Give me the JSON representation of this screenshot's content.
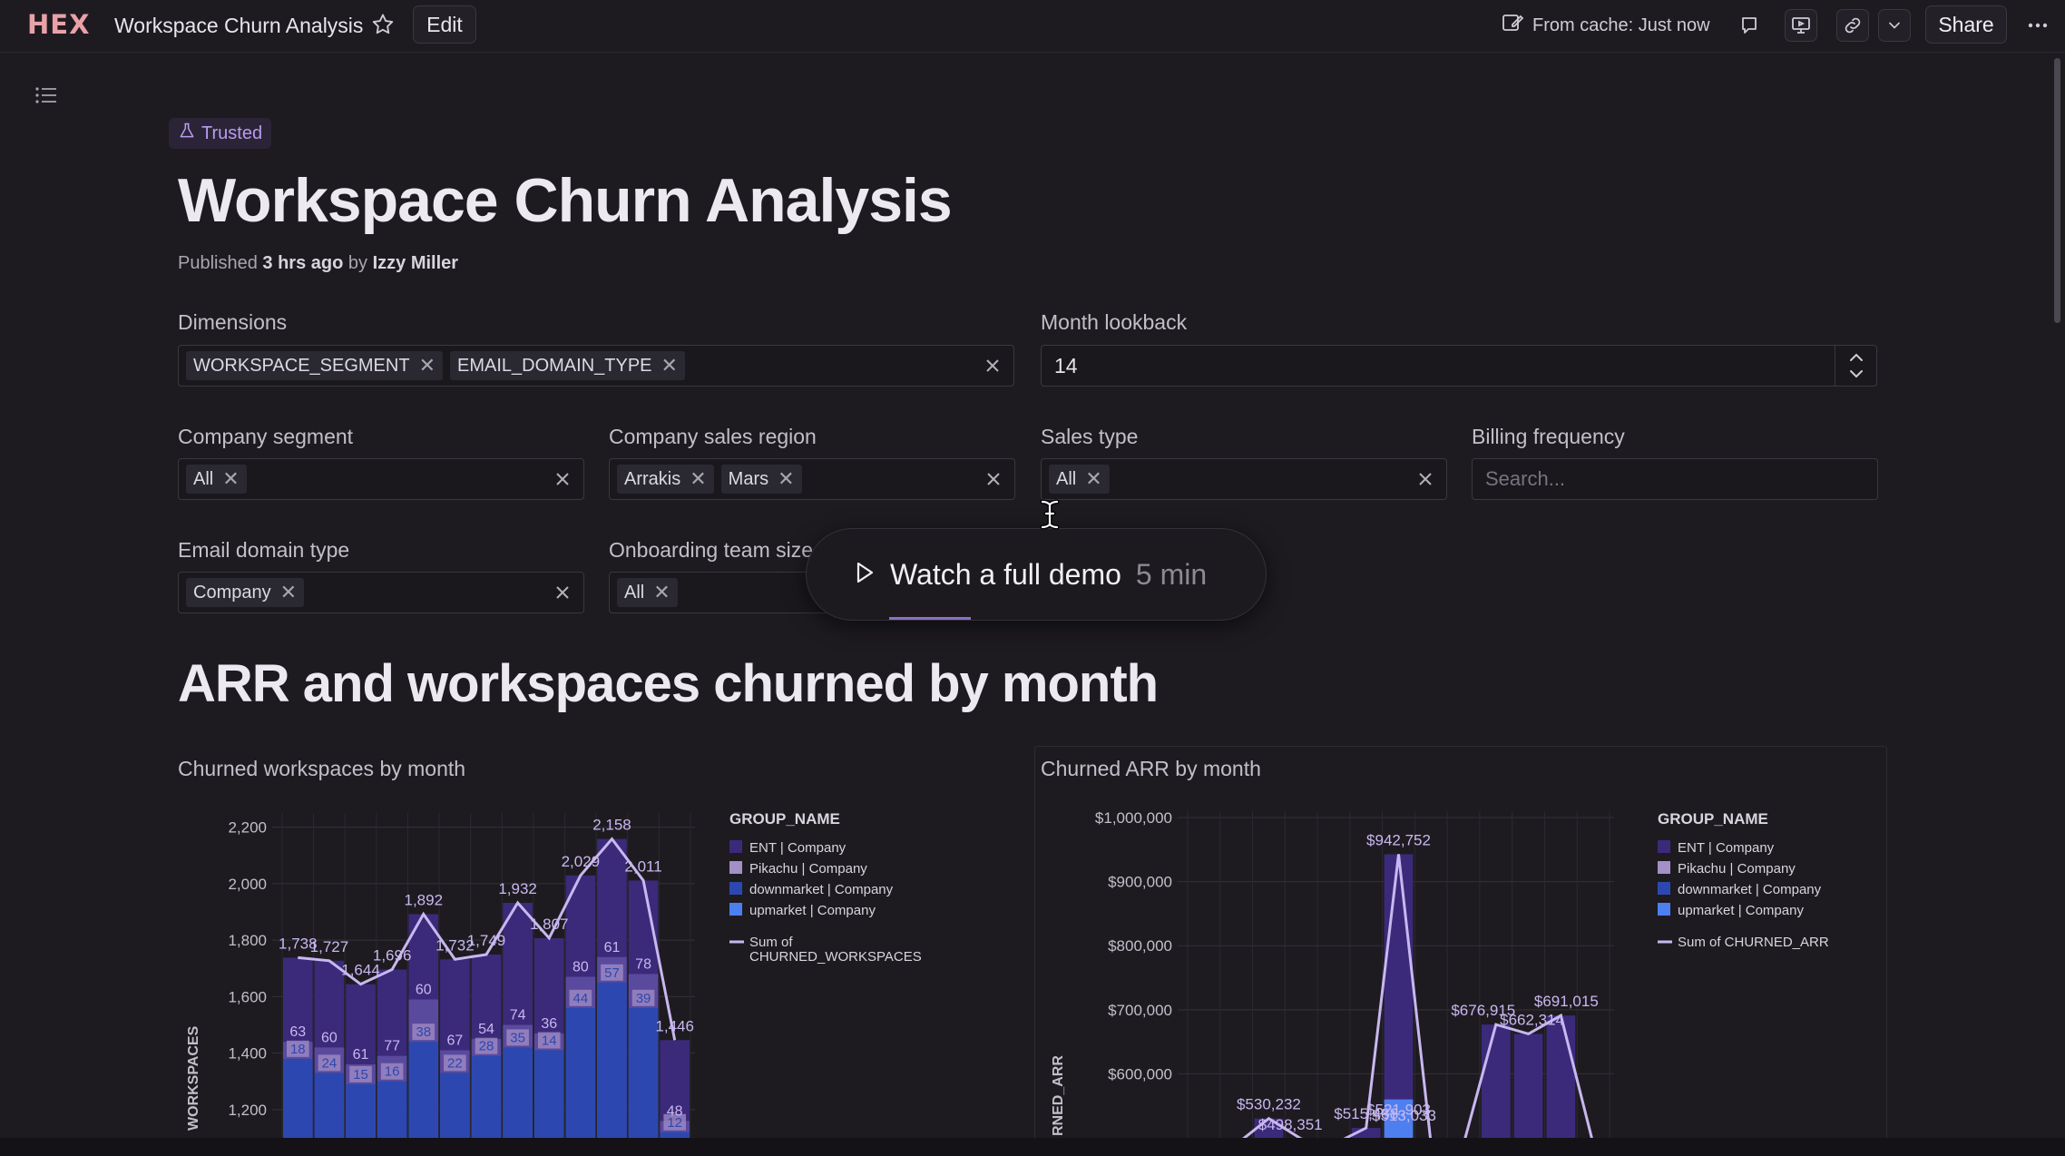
{
  "app": {
    "logo": "HEX",
    "doc_title": "Workspace Churn Analysis",
    "edit_label": "Edit",
    "cache_status": "From cache: Just now",
    "share_label": "Share"
  },
  "header": {
    "badge": "Trusted",
    "title": "Workspace Churn Analysis",
    "published_prefix": "Published",
    "published_time": "3 hrs ago",
    "published_by": "by",
    "author": "Izzy Miller"
  },
  "inputs": {
    "dimensions": {
      "label": "Dimensions",
      "tags": [
        "WORKSPACE_SEGMENT",
        "EMAIL_DOMAIN_TYPE"
      ]
    },
    "month_lookback": {
      "label": "Month lookback",
      "value": "14"
    },
    "company_segment": {
      "label": "Company segment",
      "tags": [
        "All"
      ]
    },
    "company_sales_region": {
      "label": "Company sales region",
      "tags": [
        "Arrakis",
        "Mars"
      ]
    },
    "sales_type": {
      "label": "Sales type",
      "tags": [
        "All"
      ]
    },
    "billing_frequency": {
      "label": "Billing frequency",
      "placeholder": "Search..."
    },
    "email_domain_type": {
      "label": "Email domain type",
      "tags": [
        "Company"
      ]
    },
    "onboarding_team_size": {
      "label": "Onboarding team size",
      "tags": [
        "All"
      ]
    }
  },
  "demo": {
    "label": "Watch a full demo",
    "duration": "5 min"
  },
  "section": {
    "title": "ARR and workspaces churned by month"
  },
  "icons": {
    "star": "star-icon",
    "outline": "outline-list-icon",
    "cache": "cache-edit-icon",
    "comment": "comment-icon",
    "present": "present-icon",
    "link": "link-icon",
    "chevron": "chevron-down-icon",
    "more": "more-icon",
    "play": "play-icon",
    "trusted": "trusted-flask-icon"
  },
  "colors": {
    "ent": "#3b2a7a",
    "pikachu": "#a48fc6",
    "downmarket": "#2c48b0",
    "upmarket": "#4d7ff0",
    "line": "#c9b7f0",
    "accent": "#b89cf0",
    "logo": "#e9a1a8"
  },
  "chart_data": [
    {
      "type": "bar",
      "title": "Churned workspaces by month",
      "ylabel": "WORKSPACES",
      "ylim": [
        1100,
        2250
      ],
      "yticks": [
        "2,200",
        "2,000",
        "1,800",
        "1,600",
        "1,400",
        "1,200"
      ],
      "legend_title": "GROUP_NAME",
      "legend": [
        "ENT | Company",
        "Pikachu | Company",
        "downmarket | Company",
        "upmarket | Company"
      ],
      "line_legend": [
        "Sum of",
        "CHURNED_WORKSPACES"
      ],
      "line_series": {
        "name": "Sum of CHURNED_WORKSPACES",
        "values": [
          1738,
          1727,
          1644,
          1696,
          1892,
          1732,
          1749,
          1932,
          1807,
          2029,
          2158,
          2011,
          1446
        ],
        "labels": [
          "1,738",
          "1,727",
          "1,644",
          "1,696",
          "1,892",
          "1,732",
          "1,749",
          "1,932",
          "1,807",
          "2,029",
          "2,158",
          "2,011",
          "1,446"
        ]
      },
      "segment_labels": {
        "pikachu": [
          "63",
          "60",
          "61",
          "77",
          "60",
          "67",
          "54",
          "74",
          "36",
          "80",
          "61",
          "78",
          "48"
        ],
        "upmarket": [
          "18",
          "24",
          "15",
          "16",
          "38",
          "22",
          "28",
          "35",
          "14",
          "44",
          "57",
          "39",
          "12"
        ]
      },
      "bars": [
        {
          "total": 1738,
          "upmarket": 1380,
          "pikachu": 1440
        },
        {
          "total": 1727,
          "upmarket": 1330,
          "pikachu": 1420
        },
        {
          "total": 1644,
          "upmarket": 1290,
          "pikachu": 1360
        },
        {
          "total": 1696,
          "upmarket": 1300,
          "pikachu": 1390
        },
        {
          "total": 1892,
          "upmarket": 1440,
          "pikachu": 1590
        },
        {
          "total": 1732,
          "upmarket": 1330,
          "pikachu": 1410
        },
        {
          "total": 1749,
          "upmarket": 1390,
          "pikachu": 1450
        },
        {
          "total": 1932,
          "upmarket": 1420,
          "pikachu": 1500
        },
        {
          "total": 1807,
          "upmarket": 1410,
          "pikachu": 1470
        },
        {
          "total": 2029,
          "upmarket": 1560,
          "pikachu": 1670
        },
        {
          "total": 2158,
          "upmarket": 1650,
          "pikachu": 1740
        },
        {
          "total": 2011,
          "upmarket": 1560,
          "pikachu": 1680
        },
        {
          "total": 1446,
          "upmarket": 1120,
          "pikachu": 1160
        }
      ]
    },
    {
      "type": "bar",
      "title": "Churned ARR by month",
      "ylabel": "RNED_ARR",
      "ylim": [
        500000,
        1010000
      ],
      "yticks": [
        "$1,000,000",
        "$900,000",
        "$800,000",
        "$700,000",
        "$600,000"
      ],
      "legend_title": "GROUP_NAME",
      "legend": [
        "ENT | Company",
        "Pikachu | Company",
        "downmarket | Company",
        "upmarket | Company"
      ],
      "line_legend": [
        "Sum of CHURNED_ARR"
      ],
      "annotations": [
        "$942,752",
        "$676,915",
        "$662,314",
        "$691,015",
        "$530,232",
        "$498,351",
        "$515,488",
        "$521,903",
        "$513,033"
      ]
    }
  ]
}
